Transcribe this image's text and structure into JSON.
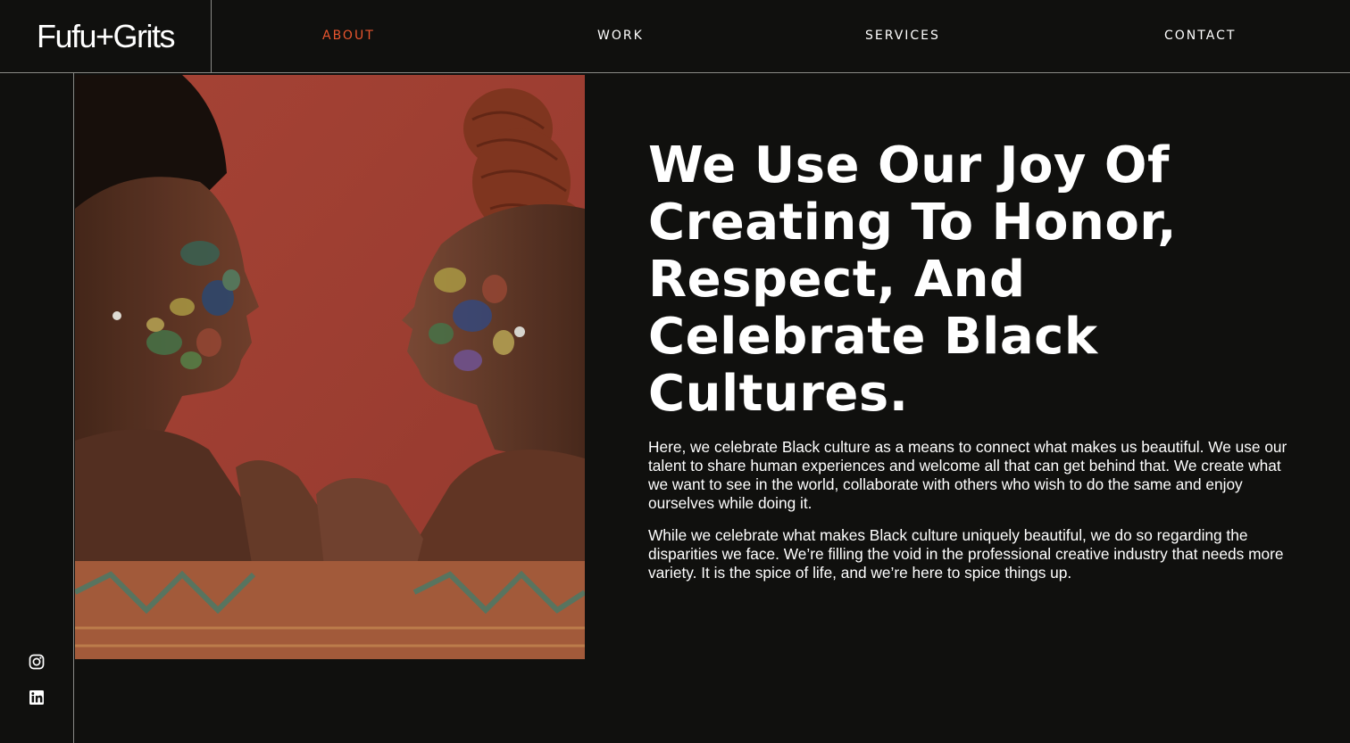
{
  "brand": {
    "logo_text": "Fufu+Grits"
  },
  "nav": {
    "items": [
      {
        "label": "ABOUT",
        "active": true
      },
      {
        "label": "WORK",
        "active": false
      },
      {
        "label": "SERVICES",
        "active": false
      },
      {
        "label": "CONTACT",
        "active": false
      }
    ],
    "active_color": "#e8552e"
  },
  "social": {
    "icons": [
      "instagram-icon",
      "linkedin-icon"
    ]
  },
  "hero": {
    "image": "two-women-with-painted-faces",
    "headline": "We Use Our Joy Of Creating To Honor, Respect, And Celebrate Black Cultures.",
    "paragraphs": [
      "Here, we celebrate Black culture as a means to connect what makes us beautiful. We use our talent to share human experiences and welcome all that can get behind that. We create what we want to see in the world, collaborate with others who wish to do the same and enjoy ourselves while doing it.",
      "While we celebrate what makes Black culture uniquely beautiful, we do so regarding the disparities we face. We’re filling the void in the professional creative industry that needs more variety. It is the spice of life, and we’re here to spice things up."
    ]
  },
  "colors": {
    "background": "#10100e",
    "accent": "#e8552e",
    "divider": "#8a8a86"
  }
}
